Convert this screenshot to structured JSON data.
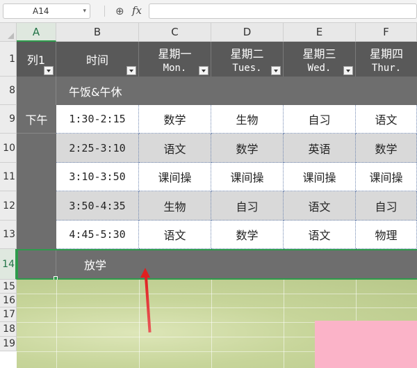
{
  "formula_bar": {
    "name_box": "A14",
    "fx_label": "fx",
    "formula": ""
  },
  "columns": [
    "A",
    "B",
    "C",
    "D",
    "E",
    "F"
  ],
  "row_numbers": [
    "1",
    "8",
    "9",
    "10",
    "11",
    "12",
    "13",
    "14",
    "15",
    "16",
    "17",
    "18",
    "19"
  ],
  "header": {
    "col1": "列1",
    "time": "时间",
    "days": [
      {
        "cn": "星期一",
        "en": "Mon."
      },
      {
        "cn": "星期二",
        "en": "Tues."
      },
      {
        "cn": "星期三",
        "en": "Wed."
      },
      {
        "cn": "星期四",
        "en": "Thur."
      }
    ]
  },
  "lunch_row": "午饭&午休",
  "afternoon_label": "下午",
  "schedule": [
    {
      "time": "1:30-2:15",
      "classes": [
        "数学",
        "生物",
        "自习",
        "语文"
      ]
    },
    {
      "time": "2:25-3:10",
      "classes": [
        "语文",
        "数学",
        "英语",
        "数学"
      ]
    },
    {
      "time": "3:10-3:50",
      "classes": [
        "课间操",
        "课间操",
        "课间操",
        "课间操"
      ]
    },
    {
      "time": "3:50-4:35",
      "classes": [
        "生物",
        "自习",
        "语文",
        "自习"
      ]
    },
    {
      "time": "4:45-5:30",
      "classes": [
        "语文",
        "数学",
        "语文",
        "物理"
      ]
    }
  ],
  "dismiss_row": "放学",
  "colors": {
    "header_bg": "#595959",
    "dark_row": "#6e6e6e",
    "selection": "#2e9b4c",
    "arrow": "#e02020",
    "stripe": "#d9d9d9"
  }
}
